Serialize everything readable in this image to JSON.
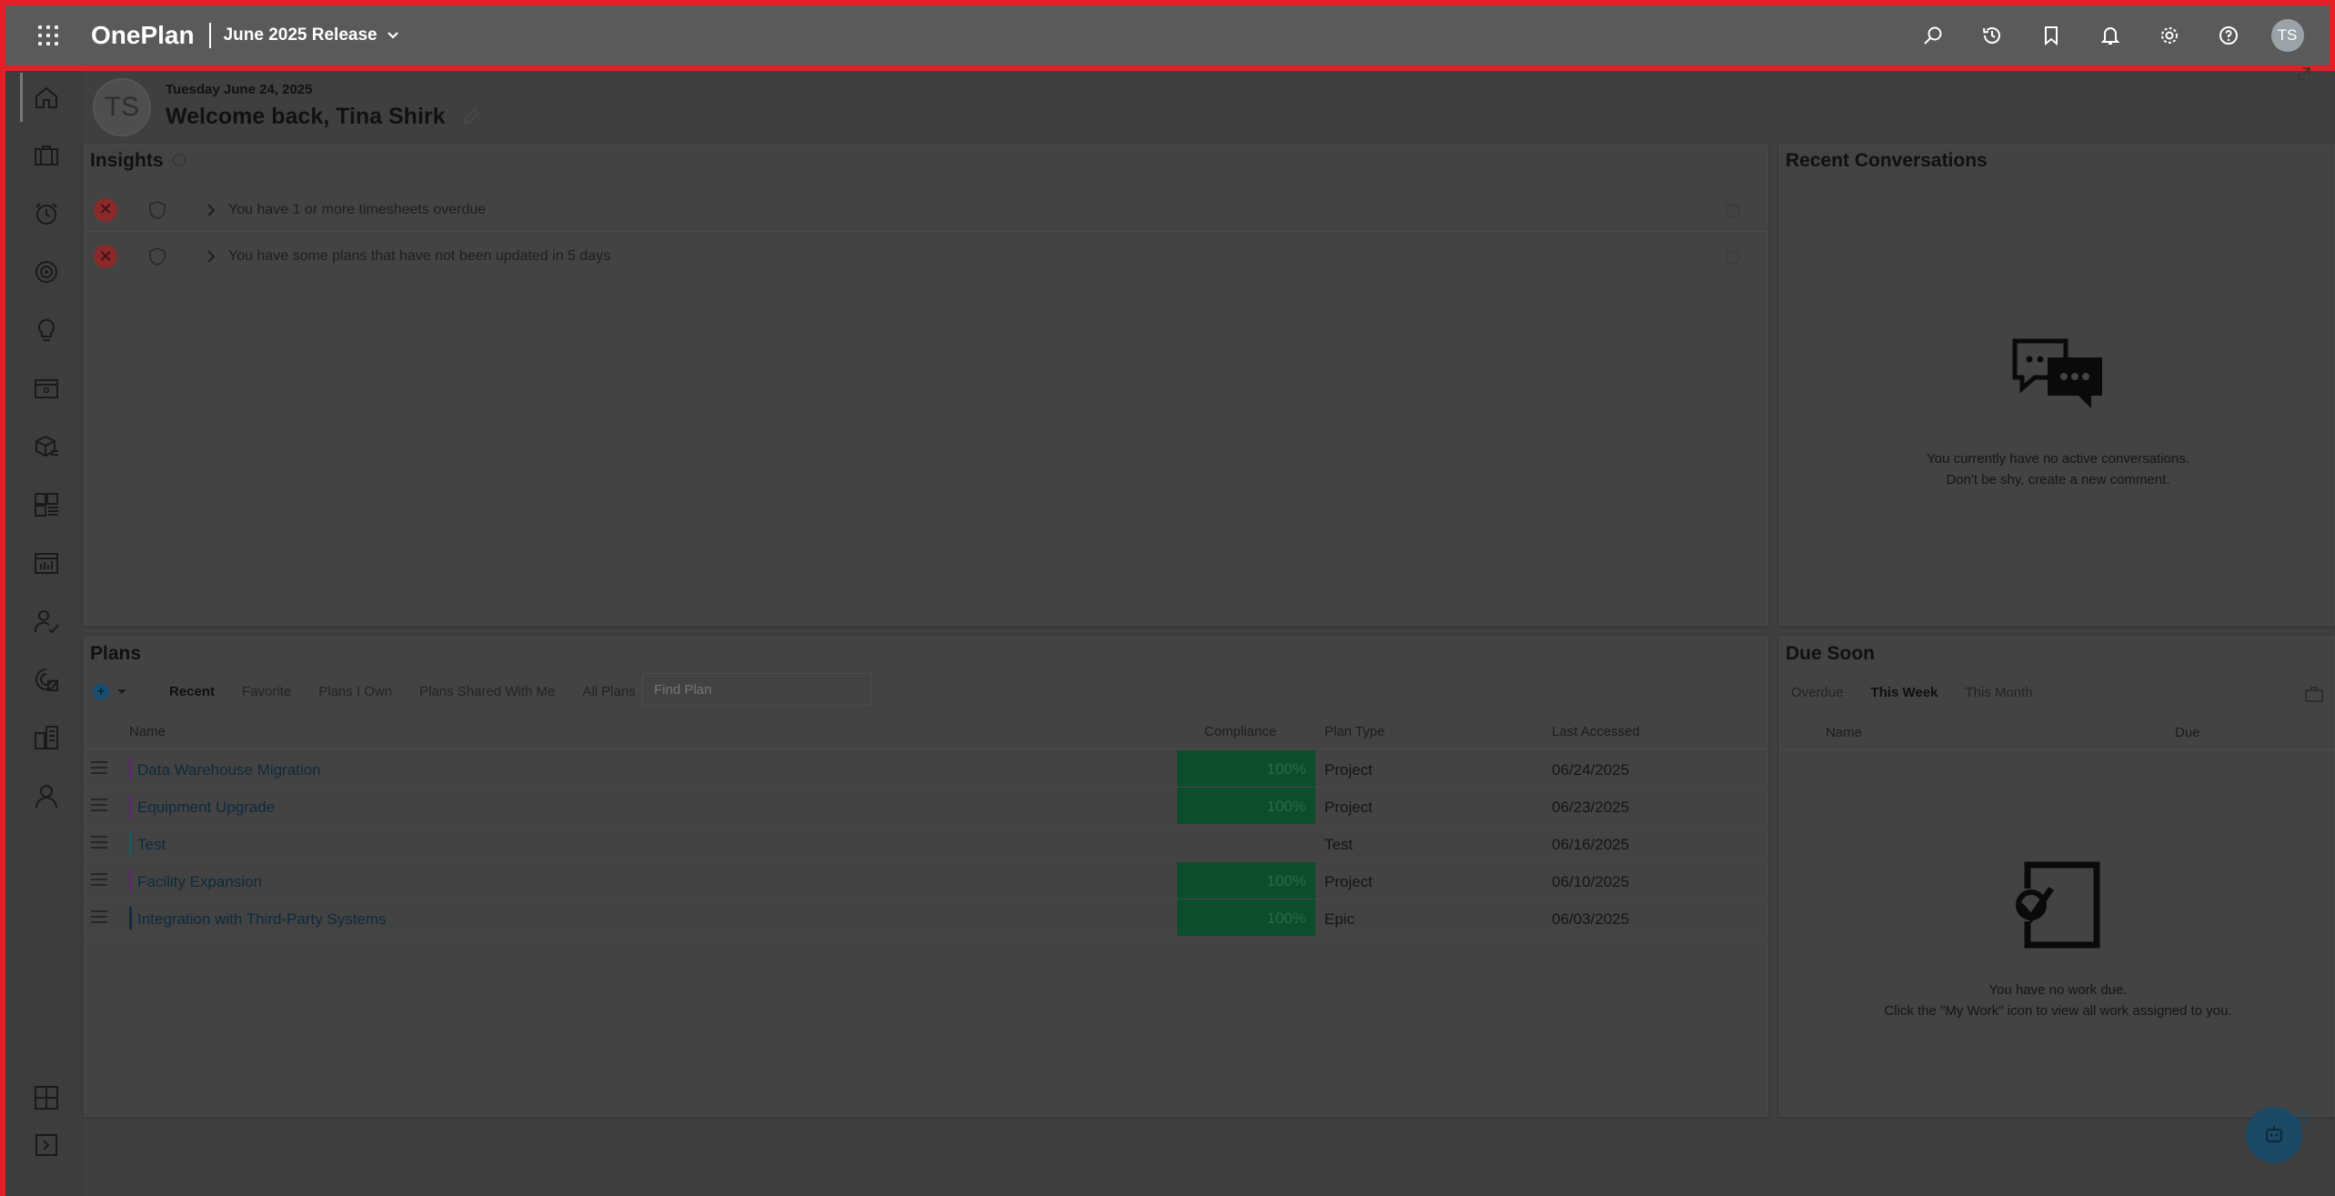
{
  "topbar": {
    "app_name": "OnePlan",
    "release": "June 2025 Release",
    "avatar_initials": "TS",
    "icons": [
      "waffle-icon",
      "search-icon",
      "history-icon",
      "bookmark-icon",
      "bell-icon",
      "gear-icon",
      "help-icon"
    ]
  },
  "rail": {
    "icons": [
      "home-icon",
      "briefcase-icon",
      "timesheet-icon",
      "target-icon",
      "lightbulb-icon",
      "board-icon",
      "package-icon",
      "grid-list-icon",
      "report-icon",
      "resource-icon",
      "portfolio-icon",
      "org-icon",
      "person-icon",
      "layout-icon",
      "expand-icon"
    ]
  },
  "welcome": {
    "initials": "TS",
    "date": "Tuesday June 24, 2025",
    "title": "Welcome back, Tina Shirk"
  },
  "insights": {
    "title": "Insights",
    "items": [
      {
        "text": "You have 1 or more timesheets overdue"
      },
      {
        "text": "You have some plans that have not been updated in 5 days"
      }
    ]
  },
  "conversations": {
    "title": "Recent Conversations",
    "empty_line1": "You currently have no active conversations.",
    "empty_line2": "Don't be shy, create a new comment."
  },
  "plans": {
    "title": "Plans",
    "tabs": [
      "Recent",
      "Favorite",
      "Plans I Own",
      "Plans Shared With Me",
      "All Plans"
    ],
    "active_tab": "Recent",
    "find_placeholder": "Find Plan",
    "columns": {
      "name": "Name",
      "compliance": "Compliance",
      "plan_type": "Plan Type",
      "last_accessed": "Last Accessed"
    },
    "rows": [
      {
        "name": "Data Warehouse Migration",
        "compliance": "100%",
        "plan_type": "Project",
        "last_accessed": "06/24/2025",
        "color": "#5a2a6a"
      },
      {
        "name": "Equipment Upgrade",
        "compliance": "100%",
        "plan_type": "Project",
        "last_accessed": "06/23/2025",
        "color": "#5a2a6a"
      },
      {
        "name": "Test",
        "compliance": "",
        "plan_type": "Test",
        "last_accessed": "06/16/2025",
        "color": "#1a5a5a"
      },
      {
        "name": "Facility Expansion",
        "compliance": "100%",
        "plan_type": "Project",
        "last_accessed": "06/10/2025",
        "color": "#5a2a6a"
      },
      {
        "name": "Integration with Third-Party Systems",
        "compliance": "100%",
        "plan_type": "Epic",
        "last_accessed": "06/03/2025",
        "color": "#1a2a3a"
      }
    ]
  },
  "due_soon": {
    "title": "Due Soon",
    "tabs": [
      "Overdue",
      "This Week",
      "This Month"
    ],
    "active_tab": "This Week",
    "columns": {
      "name": "Name",
      "due": "Due"
    },
    "empty_line1": "You have no work due.",
    "empty_line2": "Click the \"My Work\" icon to view all work assigned to you."
  },
  "colors": {
    "accent": "#e41e26",
    "compliance_fill": "#0b4d2d",
    "fab": "#1c4a66"
  }
}
